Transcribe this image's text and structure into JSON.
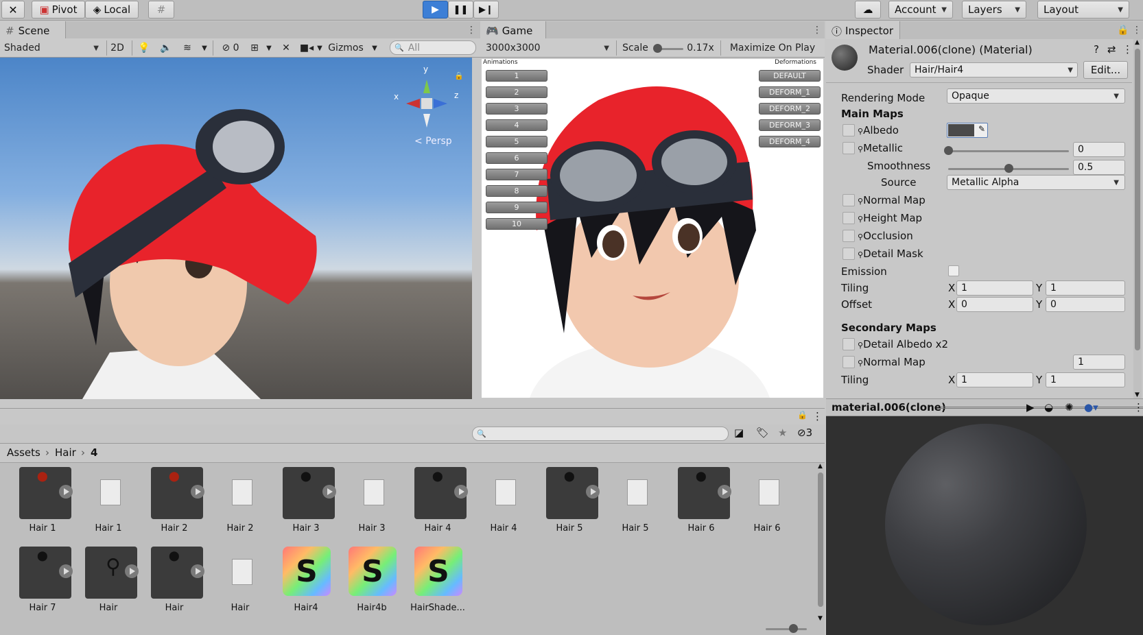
{
  "toolbar": {
    "pivot": "Pivot",
    "local": "Local",
    "account": "Account",
    "layers": "Layers",
    "layout": "Layout"
  },
  "scene": {
    "tab": "Scene",
    "shading": "Shaded",
    "btn_2d": "2D",
    "hidden_count": "0",
    "gizmos": "Gizmos",
    "search_placeholder": "All",
    "persp": "Persp",
    "axis_x": "x",
    "axis_y": "y",
    "axis_z": "z"
  },
  "game": {
    "tab": "Game",
    "resolution": "3000x3000",
    "scale_label": "Scale",
    "scale_value": "0.17x",
    "maximize": "Maximize On Play",
    "animations_title": "Animations",
    "deformations_title": "Deformations",
    "animations": [
      "1",
      "2",
      "3",
      "4",
      "5",
      "6",
      "7",
      "8",
      "9",
      "10"
    ],
    "deformations": [
      "DEFAULT",
      "DEFORM_1",
      "DEFORM_2",
      "DEFORM_3",
      "DEFORM_4"
    ]
  },
  "inspector": {
    "tab": "Inspector",
    "material_name": "Material.006(clone) (Material)",
    "shader_label": "Shader",
    "shader_value": "Hair/Hair4",
    "edit": "Edit...",
    "rendering_mode_label": "Rendering Mode",
    "rendering_mode_value": "Opaque",
    "main_maps": "Main Maps",
    "albedo": "Albedo",
    "metallic": "Metallic",
    "metallic_value": "0",
    "smoothness": "Smoothness",
    "smoothness_value": "0.5",
    "source": "Source",
    "source_value": "Metallic Alpha",
    "normal_map": "Normal Map",
    "height_map": "Height Map",
    "occlusion": "Occlusion",
    "detail_mask": "Detail Mask",
    "emission": "Emission",
    "tiling": "Tiling",
    "offset": "Offset",
    "x": "X",
    "y": "Y",
    "tiling_x": "1",
    "tiling_y": "1",
    "offset_x": "0",
    "offset_y": "0",
    "secondary_maps": "Secondary Maps",
    "detail_albedo": "Detail Albedo x2",
    "normal_map2": "Normal Map",
    "normal_map2_value": "1",
    "tiling2": "Tiling",
    "tiling2_x": "1",
    "tiling2_y": "1",
    "preview_title": "material.006(clone)"
  },
  "project": {
    "breadcrumb": [
      "Assets",
      "Hair",
      "4"
    ],
    "hidden_count": "3",
    "assets": [
      {
        "name": "Hair 1"
      },
      {
        "name": "Hair 1"
      },
      {
        "name": "Hair 2"
      },
      {
        "name": "Hair 2"
      },
      {
        "name": "Hair 3"
      },
      {
        "name": "Hair 3"
      },
      {
        "name": "Hair 4"
      },
      {
        "name": "Hair 4"
      },
      {
        "name": "Hair 5"
      },
      {
        "name": "Hair 5"
      },
      {
        "name": "Hair 6"
      },
      {
        "name": "Hair 6"
      },
      {
        "name": "Hair 7"
      },
      {
        "name": "Hair"
      },
      {
        "name": "Hair"
      },
      {
        "name": "Hair"
      },
      {
        "name": "Hair4"
      },
      {
        "name": "Hair4b"
      },
      {
        "name": "HairShade..."
      }
    ]
  },
  "colors": {
    "play_active": "#3d7fd6",
    "cap_red": "#e8232b",
    "hair": "#15151a"
  }
}
